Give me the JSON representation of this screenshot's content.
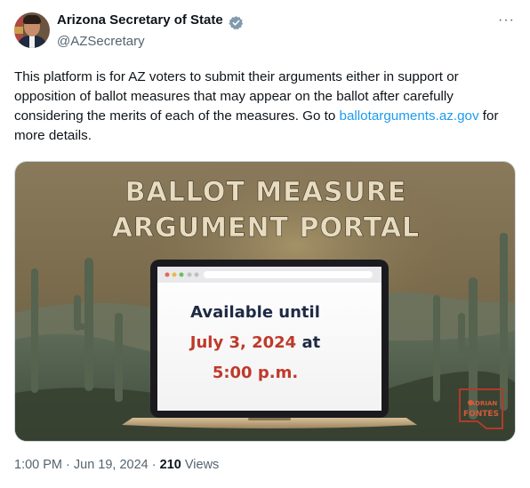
{
  "author": {
    "display_name": "Arizona Secretary of State",
    "handle": "@AZSecretary",
    "verified_color": "#829aab"
  },
  "tweet": {
    "text_before_link": "This platform is for AZ voters to submit their arguments either in support or opposition of ballot measures that may appear on the ballot after carefully considering the merits of each of the measures. Go to ",
    "link_text": "ballotarguments.az.gov",
    "text_after_link": " for more details.",
    "link_color": "#1d9bf0"
  },
  "media": {
    "headline_line1": "BALLOT MEASURE",
    "headline_line2": "ARGUMENT PORTAL",
    "laptop_line1": "Available until",
    "laptop_date": "July 3, 2024",
    "laptop_at": " at",
    "laptop_time": "5:00 p.m.",
    "badge_line1": "ADRIAN",
    "badge_line2": "FONTES",
    "colors": {
      "headline": "#e8dcc0",
      "navy": "#1e2a44",
      "red": "#c0392b"
    }
  },
  "meta": {
    "time": "1:00 PM",
    "separator": " · ",
    "date": "Jun 19, 2024",
    "views_count": "210",
    "views_label": " Views"
  }
}
